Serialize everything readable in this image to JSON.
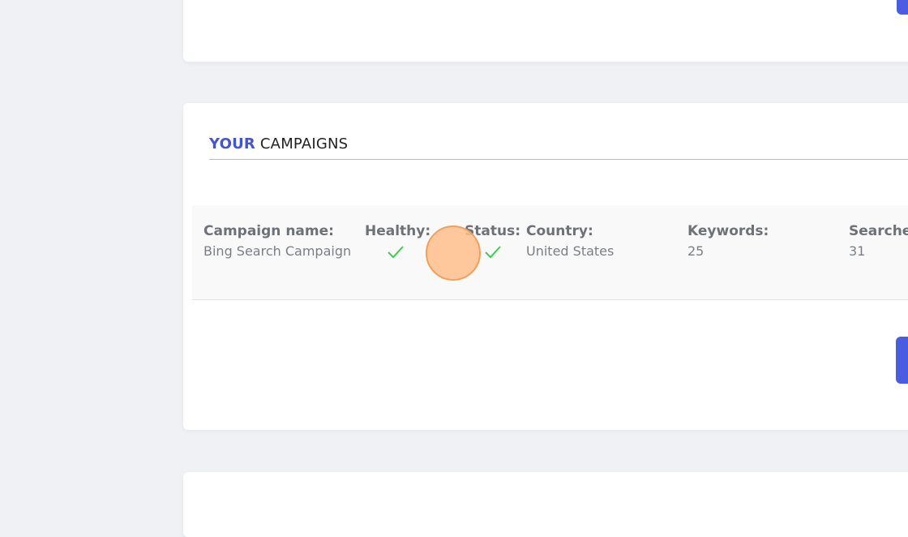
{
  "campaigns_section": {
    "title_accent": "YOUR",
    "title_rest": "CAMPAIGNS",
    "columns": {
      "name_label": "Campaign name:",
      "healthy_label": "Healthy:",
      "status_label": "Status:",
      "country_label": "Country:",
      "keywords_label": "Keywords:",
      "searches_label": "Searches:"
    },
    "campaign": {
      "name": "Bing Search Campaign",
      "healthy_icon": "check-icon",
      "status_icon": "check-icon",
      "country": "United States",
      "keywords": "25",
      "searches": "31"
    }
  },
  "colors": {
    "accent": "#4455cc",
    "button": "#4a5de0",
    "check": "#3ccf4e"
  }
}
